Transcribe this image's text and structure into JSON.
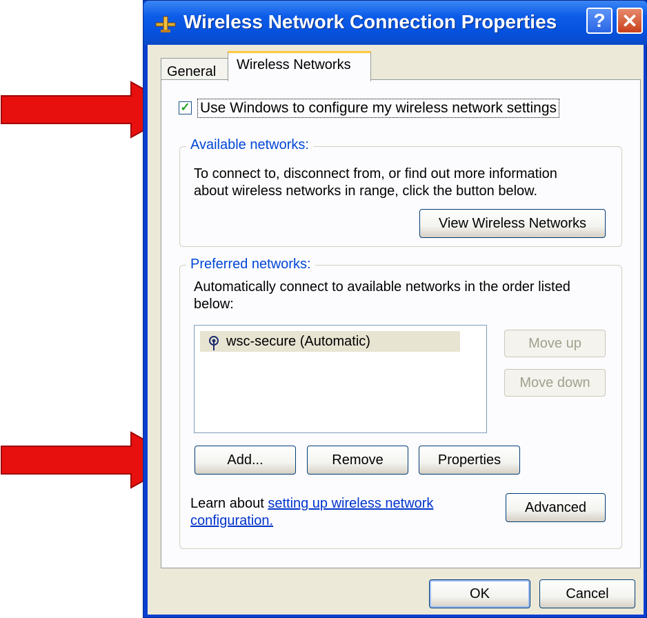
{
  "window": {
    "title": "Wireless Network Connection Properties",
    "help_label": "?",
    "close_label": "✕"
  },
  "tabs": [
    {
      "label": "General",
      "active": false
    },
    {
      "label": "Wireless Networks",
      "active": true
    }
  ],
  "use_windows_checkbox": {
    "checked": true,
    "label": "Use Windows to configure my wireless network settings"
  },
  "available": {
    "legend": "Available networks:",
    "description_line1": "To connect to, disconnect from, or find out more information",
    "description_line2": "about wireless networks in range, click the button below.",
    "view_button": "View Wireless Networks"
  },
  "preferred": {
    "legend": "Preferred networks:",
    "description_line1": "Automatically connect to available networks in the order listed",
    "description_line2": "below:",
    "networks": [
      {
        "label": "wsc-secure (Automatic)",
        "icon": "wireless-antenna-icon"
      }
    ],
    "move_up": "Move up",
    "move_down": "Move down",
    "add": "Add...",
    "remove": "Remove",
    "properties": "Properties",
    "learn_prefix": "Learn about",
    "learn_link_line1": "setting up wireless network",
    "learn_link_line2": "configuration.",
    "advanced": "Advanced"
  },
  "footer": {
    "ok": "OK",
    "cancel": "Cancel"
  },
  "colors": {
    "titlebar": "#0552df",
    "arrow": "#e8100e",
    "legend": "#0046d5"
  }
}
